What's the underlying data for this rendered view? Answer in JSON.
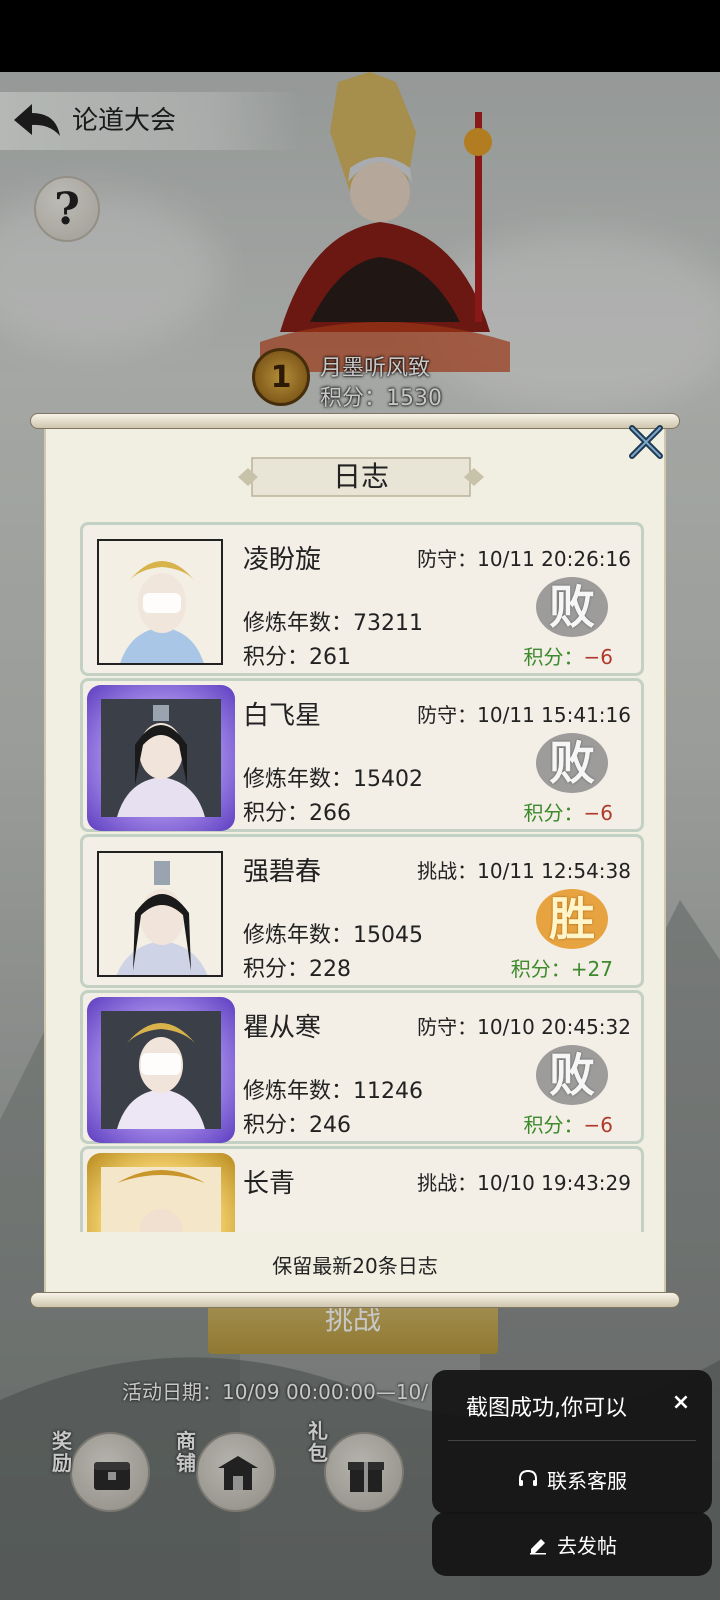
{
  "header": {
    "title": "论道大会",
    "help_label": "?"
  },
  "champion": {
    "rank": "1",
    "name": "月墨听风致",
    "score": "积分：1530"
  },
  "dialog": {
    "title": "日志",
    "close_icon": "close-x-icon",
    "entries": [
      {
        "name": "凌盼旋",
        "meta": "防守：10/11 20:26:16",
        "years": "修炼年数：73211",
        "score": "积分：261",
        "result": "败",
        "delta_label": "积分：",
        "delta_value": "−6",
        "frame": "plain"
      },
      {
        "name": "白飞星",
        "meta": "防守：10/11 15:41:16",
        "years": "修炼年数：15402",
        "score": "积分：266",
        "result": "败",
        "delta_label": "积分：",
        "delta_value": "−6",
        "frame": "rare"
      },
      {
        "name": "强碧春",
        "meta": "挑战：10/11 12:54:38",
        "years": "修炼年数：15045",
        "score": "积分：228",
        "result": "胜",
        "delta_label": "积分：",
        "delta_value": "+27",
        "frame": "plain"
      },
      {
        "name": "瞿从寒",
        "meta": "防守：10/10 20:45:32",
        "years": "修炼年数：11246",
        "score": "积分：246",
        "result": "败",
        "delta_label": "积分：",
        "delta_value": "−6",
        "frame": "rare"
      },
      {
        "name": "长青",
        "meta": "挑战：10/10 19:43:29",
        "frame": "legend"
      }
    ],
    "footer_note": "保留最新20条日志"
  },
  "background": {
    "challenge_label": "挑战",
    "activity_date": "活动日期：10/09 00:00:00—10/",
    "nav": [
      {
        "label": "奖励",
        "icon": "reward-chest-icon"
      },
      {
        "label": "商铺",
        "icon": "shop-pavilion-icon"
      },
      {
        "label": "礼包",
        "icon": "gift-box-icon"
      }
    ]
  },
  "toast": {
    "message": "截图成功,你可以",
    "close": "×",
    "contact_label": "联系客服",
    "post_label": "去发帖"
  },
  "colors": {
    "panel_bg": "#f1efe2",
    "row_bg": "#f3eee6",
    "row_border": "#c3d0c4",
    "delta_label": "#3c8a2c",
    "delta_negative": "#b03a2a",
    "delta_positive": "#3c8a2c",
    "toast_bg": "#141414"
  }
}
